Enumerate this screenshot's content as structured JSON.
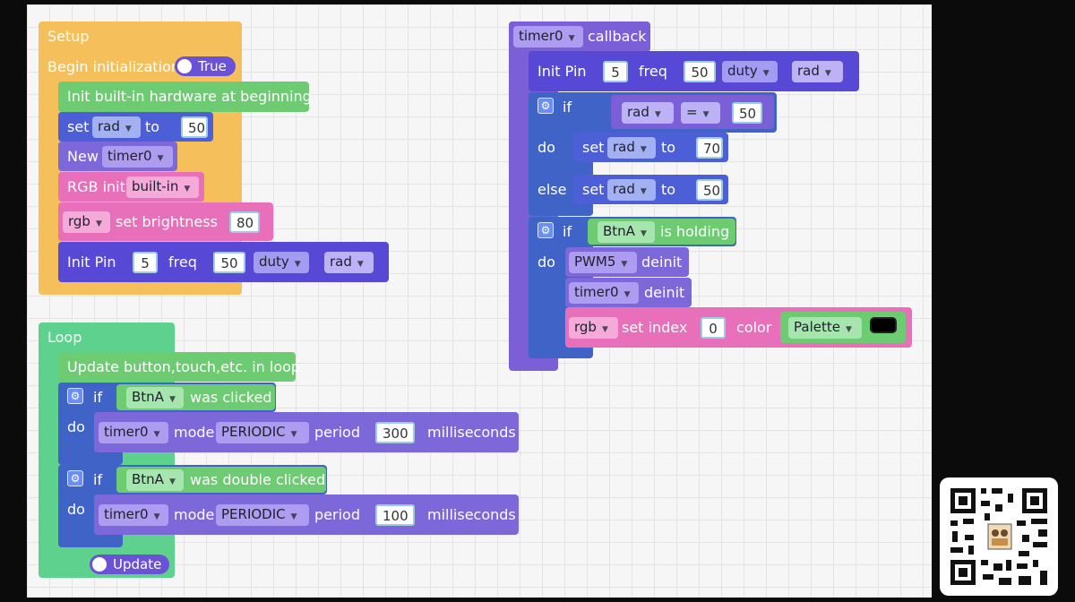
{
  "setup": {
    "title": "Setup",
    "begin_label": "Begin initialization",
    "begin_value": "True",
    "init_hw": "Init built-in hardware at beginning",
    "set_kw": "set",
    "set_var": "rad",
    "to_kw": "to",
    "set_value": "50",
    "new_kw": "New",
    "new_var": "timer0",
    "rgb_init_kw": "RGB init",
    "rgb_init_val": "built-in",
    "rgb_var": "rgb",
    "brightness_kw": "set brightness",
    "brightness_val": "80",
    "init_pin_kw": "Init Pin",
    "pin_val": "5",
    "freq_kw": "freq",
    "freq_val": "50",
    "duty_kw": "duty",
    "duty_var": "rad"
  },
  "loop": {
    "title": "Loop",
    "update_label": "Update button,touch,etc. in loop",
    "if1": {
      "if_kw": "if",
      "do_kw": "do",
      "btn": "BtnA",
      "event": "was clicked",
      "timer": "timer0",
      "mode_kw": "mode",
      "mode": "PERIODIC",
      "period_kw": "period",
      "period": "300",
      "unit": "milliseconds"
    },
    "if2": {
      "if_kw": "if",
      "do_kw": "do",
      "btn": "BtnA",
      "event": "was double clicked",
      "timer": "timer0",
      "mode_kw": "mode",
      "mode": "PERIODIC",
      "period_kw": "period",
      "period": "100",
      "unit": "milliseconds"
    },
    "update_toggle": "Update"
  },
  "callback": {
    "timer": "timer0",
    "callback_kw": "callback",
    "init_pin_kw": "Init Pin",
    "pin_val": "5",
    "freq_kw": "freq",
    "freq_val": "50",
    "duty_kw": "duty",
    "duty_var": "rad",
    "if_kw": "if",
    "cond_var": "rad",
    "cond_op": "=",
    "cond_val": "50",
    "do_kw": "do",
    "else_kw": "else",
    "set_kw": "set",
    "set_var": "rad",
    "to_kw": "to",
    "do_val": "70",
    "else_val": "50",
    "if2_kw": "if",
    "btn": "BtnA",
    "btn_event": "is holding",
    "do2_kw": "do",
    "pwm": "PWM5",
    "deinit_kw": "deinit",
    "timer2": "timer0",
    "deinit2_kw": "deinit",
    "rgb_var": "rgb",
    "set_index_kw": "set index",
    "index_val": "0",
    "color_kw": "color",
    "palette": "Palette",
    "palette_color": "#000000"
  },
  "icons": {
    "dropdown": "▼",
    "gear": "⚙"
  }
}
